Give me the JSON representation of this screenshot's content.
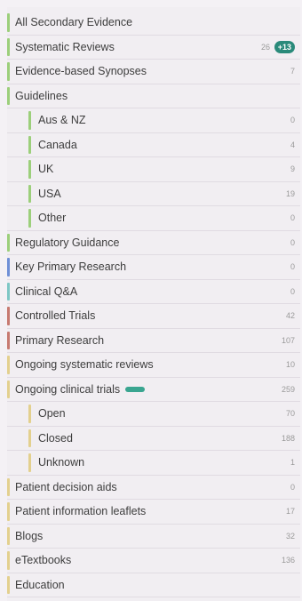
{
  "colors": {
    "green": "#9ccf7b",
    "blue": "#6f8fd6",
    "teal": "#7ec7c5",
    "red": "#c77a71",
    "yellow": "#e3d08e",
    "badge": "#2a8a7a"
  },
  "rows": [
    {
      "label": "All Secondary Evidence",
      "count": "",
      "bar": "green",
      "indent": 0
    },
    {
      "label": "Systematic Reviews",
      "count": "26",
      "badge": "+13",
      "bar": "green",
      "indent": 0
    },
    {
      "label": "Evidence-based Synopses",
      "count": "7",
      "bar": "green",
      "indent": 0
    },
    {
      "label": "Guidelines",
      "count": "",
      "bar": "green",
      "indent": 0
    },
    {
      "label": "Aus & NZ",
      "count": "0",
      "bar": "green",
      "indent": 1
    },
    {
      "label": "Canada",
      "count": "4",
      "bar": "green",
      "indent": 1
    },
    {
      "label": "UK",
      "count": "9",
      "bar": "green",
      "indent": 1
    },
    {
      "label": "USA",
      "count": "19",
      "bar": "green",
      "indent": 1
    },
    {
      "label": "Other",
      "count": "0",
      "bar": "green",
      "indent": 1
    },
    {
      "label": "Regulatory Guidance",
      "count": "0",
      "bar": "green",
      "indent": 0
    },
    {
      "label": "Key Primary Research",
      "count": "0",
      "bar": "blue",
      "indent": 0
    },
    {
      "label": "Clinical Q&A",
      "count": "0",
      "bar": "teal",
      "indent": 0
    },
    {
      "label": "Controlled Trials",
      "count": "42",
      "bar": "red",
      "indent": 0
    },
    {
      "label": "Primary Research",
      "count": "107",
      "bar": "red",
      "indent": 0
    },
    {
      "label": "Ongoing systematic reviews",
      "count": "10",
      "bar": "yellow",
      "indent": 0
    },
    {
      "label": "Ongoing clinical trials",
      "count": "259",
      "bar": "yellow",
      "indent": 0,
      "tag": true
    },
    {
      "label": "Open",
      "count": "70",
      "bar": "yellow",
      "indent": 1
    },
    {
      "label": "Closed",
      "count": "188",
      "bar": "yellow",
      "indent": 1
    },
    {
      "label": "Unknown",
      "count": "1",
      "bar": "yellow",
      "indent": 1
    },
    {
      "label": "Patient decision aids",
      "count": "0",
      "bar": "yellow",
      "indent": 0
    },
    {
      "label": "Patient information leaflets",
      "count": "17",
      "bar": "yellow",
      "indent": 0
    },
    {
      "label": "Blogs",
      "count": "32",
      "bar": "yellow",
      "indent": 0
    },
    {
      "label": "eTextbooks",
      "count": "136",
      "bar": "yellow",
      "indent": 0
    },
    {
      "label": "Education",
      "count": "",
      "bar": "yellow",
      "indent": 0
    }
  ]
}
